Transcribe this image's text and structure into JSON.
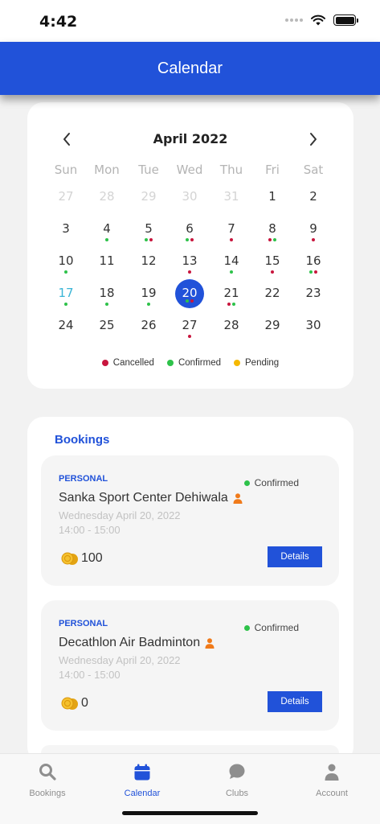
{
  "status_bar": {
    "time": "4:42"
  },
  "header": {
    "title": "Calendar"
  },
  "calendar": {
    "month_label": "April 2022",
    "weekdays": [
      "Sun",
      "Mon",
      "Tue",
      "Wed",
      "Thu",
      "Fri",
      "Sat"
    ],
    "weeks": [
      [
        {
          "n": "27",
          "other": true
        },
        {
          "n": "28",
          "other": true
        },
        {
          "n": "29",
          "other": true
        },
        {
          "n": "30",
          "other": true
        },
        {
          "n": "31",
          "other": true
        },
        {
          "n": "1"
        },
        {
          "n": "2"
        }
      ],
      [
        {
          "n": "3"
        },
        {
          "n": "4",
          "dots": [
            "confirmed"
          ]
        },
        {
          "n": "5",
          "dots": [
            "confirmed",
            "cancelled"
          ]
        },
        {
          "n": "6",
          "dots": [
            "confirmed",
            "cancelled"
          ]
        },
        {
          "n": "7",
          "dots": [
            "cancelled"
          ]
        },
        {
          "n": "8",
          "dots": [
            "cancelled",
            "confirmed"
          ]
        },
        {
          "n": "9",
          "dots": [
            "cancelled"
          ]
        }
      ],
      [
        {
          "n": "10",
          "dots": [
            "confirmed"
          ]
        },
        {
          "n": "11"
        },
        {
          "n": "12"
        },
        {
          "n": "13",
          "dots": [
            "cancelled"
          ]
        },
        {
          "n": "14",
          "dots": [
            "confirmed"
          ]
        },
        {
          "n": "15",
          "dots": [
            "cancelled"
          ]
        },
        {
          "n": "16",
          "dots": [
            "confirmed",
            "cancelled"
          ]
        }
      ],
      [
        {
          "n": "17",
          "today": true,
          "dots": [
            "confirmed"
          ]
        },
        {
          "n": "18",
          "dots": [
            "confirmed"
          ]
        },
        {
          "n": "19",
          "dots": [
            "confirmed"
          ]
        },
        {
          "n": "20",
          "selected": true,
          "dots": [
            "confirmed",
            "cancelled"
          ]
        },
        {
          "n": "21",
          "dots": [
            "cancelled",
            "confirmed"
          ]
        },
        {
          "n": "22"
        },
        {
          "n": "23"
        }
      ],
      [
        {
          "n": "24"
        },
        {
          "n": "25"
        },
        {
          "n": "26"
        },
        {
          "n": "27",
          "dots": [
            "cancelled"
          ]
        },
        {
          "n": "28"
        },
        {
          "n": "29"
        },
        {
          "n": "30"
        }
      ]
    ],
    "legend": [
      {
        "key": "cancelled",
        "label": "Cancelled",
        "color": "#c8163e"
      },
      {
        "key": "confirmed",
        "label": "Confirmed",
        "color": "#2ec24a"
      },
      {
        "key": "pending",
        "label": "Pending",
        "color": "#f5b800"
      }
    ]
  },
  "bookings": {
    "title": "Bookings",
    "details_label": "Details",
    "items": [
      {
        "type": "PERSONAL",
        "status": "Confirmed",
        "venue": "Sanka Sport Center Dehiwala",
        "date": "Wednesday April 20, 2022",
        "time": "14:00 - 15:00",
        "points": "100"
      },
      {
        "type": "PERSONAL",
        "status": "Confirmed",
        "venue": "Decathlon Air Badminton",
        "date": "Wednesday April 20, 2022",
        "time": "14:00 - 15:00",
        "points": "0"
      }
    ]
  },
  "bottom_nav": [
    {
      "key": "bookings",
      "label": "Bookings",
      "icon": "search-icon"
    },
    {
      "key": "calendar",
      "label": "Calendar",
      "icon": "calendar-icon",
      "active": true
    },
    {
      "key": "clubs",
      "label": "Clubs",
      "icon": "chat-bubble-icon"
    },
    {
      "key": "account",
      "label": "Account",
      "icon": "person-icon"
    }
  ],
  "colors": {
    "primary": "#2152d9",
    "cancelled": "#c8163e",
    "confirmed": "#2ec24a",
    "pending": "#f5b800",
    "today": "#3ab5d6"
  }
}
